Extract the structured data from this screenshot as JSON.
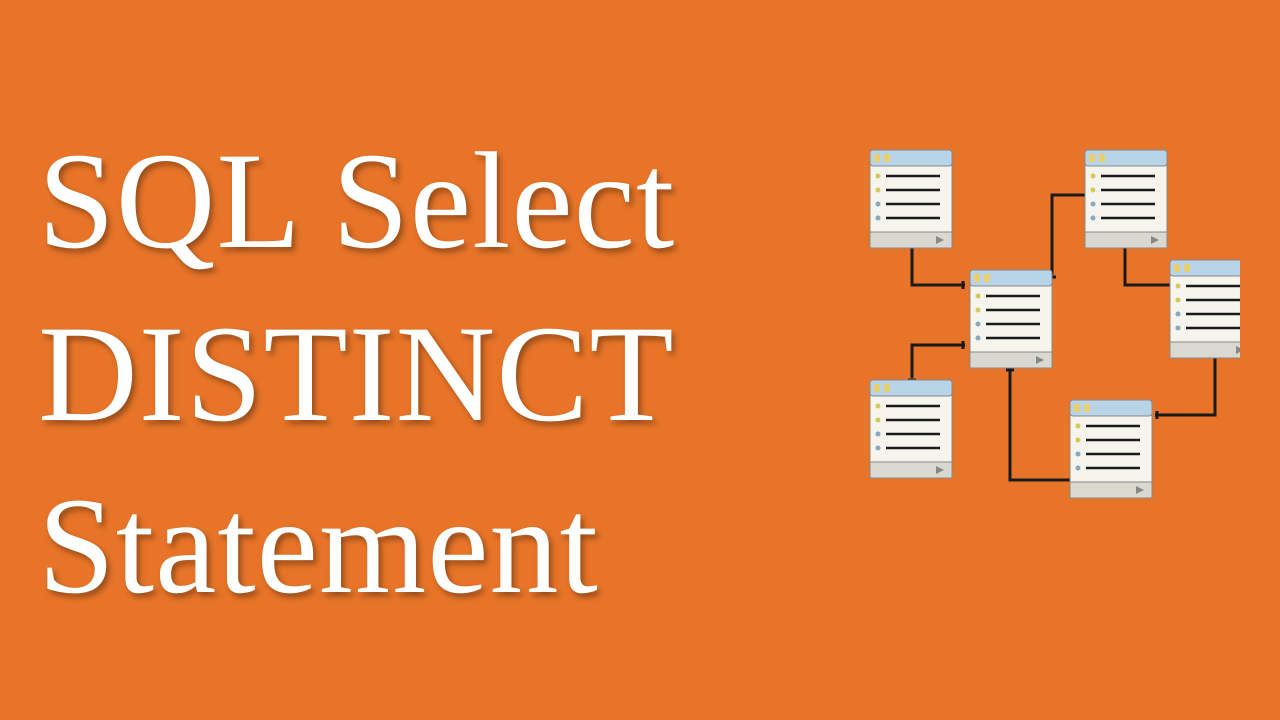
{
  "title": {
    "line1": "SQL Select",
    "line2": "DISTINCT",
    "line3": "Statement"
  },
  "diagram": {
    "description": "database-schema-diagram",
    "tables_count": 6,
    "layout": "hexagonal",
    "colors": {
      "background": "#e77428",
      "table_header": "#b8d4e8",
      "table_body": "#f5f5ee",
      "table_footer": "#d9d9d0",
      "connector": "#1a1a1a"
    }
  }
}
